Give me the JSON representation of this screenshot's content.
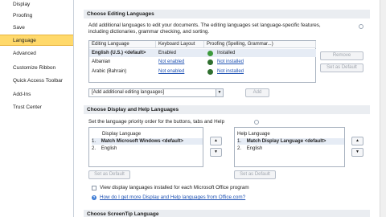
{
  "nav": {
    "items": [
      {
        "label": "Display"
      },
      {
        "label": "Proofing"
      },
      {
        "label": "Save"
      },
      {
        "label": "Language"
      },
      {
        "label": "Advanced"
      },
      {
        "label": "Customize Ribbon"
      },
      {
        "label": "Quick Access Toolbar"
      },
      {
        "label": "Add-Ins"
      },
      {
        "label": "Trust Center"
      }
    ],
    "selected": "Language"
  },
  "editing": {
    "heading": "Choose Editing Languages",
    "description_line1": "Add additional languages to edit your documents. The editing languages set language-specific features,",
    "description_line2": "including dictionaries, grammar checking, and sorting.",
    "columns": [
      "Editing Language",
      "Keyboard Layout",
      "Proofing (Spelling, Grammar...)"
    ],
    "rows": [
      {
        "language": "English (U.S.) <default>",
        "keyboard": "Enabled",
        "proofing": "Installed"
      },
      {
        "language": "Albanian",
        "keyboard": "Not enabled",
        "proofing": "Not installed"
      },
      {
        "language": "Arabic (Bahrain)",
        "keyboard": "Not enabled",
        "proofing": "Not installed"
      }
    ],
    "add_placeholder": "[Add additional editing languages]",
    "add_button": "Add",
    "remove_button": "Remove",
    "set_default_button": "Set as Default"
  },
  "display": {
    "heading": "Choose Display and Help Languages",
    "description": "Set the language priority order for the buttons, tabs and Help",
    "display_list_header": "Display Language",
    "display_items": [
      {
        "num": "1.",
        "label": "Match Microsoft Windows <default>"
      },
      {
        "num": "2.",
        "label": "English"
      }
    ],
    "help_list_header": "Help Language",
    "help_items": [
      {
        "num": "1.",
        "label": "Match Display Language <default>"
      },
      {
        "num": "2.",
        "label": "English"
      }
    ],
    "set_default_button": "Set as Default",
    "checkbox_label": "View display languages installed for each Microsoft Office program",
    "link_label": "How do I get more Display and Help languages from Office.com?"
  },
  "screentip": {
    "heading": "Choose ScreenTip Language"
  }
}
